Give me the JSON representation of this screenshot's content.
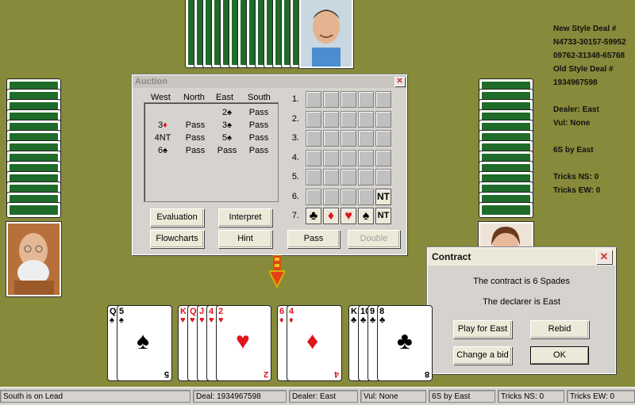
{
  "info": {
    "new_style_label": "New Style Deal #",
    "new_style_1": "N4733-30157-59952",
    "new_style_2": "09762-31348-65768",
    "old_style_label": "Old Style Deal #",
    "old_style_value": "1934967598",
    "dealer": "Dealer: East",
    "vul": "Vul: None",
    "contract": "6S by East",
    "tricks_ns": "Tricks NS: 0",
    "tricks_ew": "Tricks EW: 0"
  },
  "auction": {
    "title": "Auction",
    "headers": [
      "West",
      "North",
      "East",
      "South"
    ],
    "rows": [
      [
        "",
        "",
        "2♠",
        "Pass"
      ],
      [
        "3♦",
        "Pass",
        "3♠",
        "Pass"
      ],
      [
        "4NT",
        "Pass",
        "5♠",
        "Pass"
      ],
      [
        "6♠",
        "Pass",
        "Pass",
        "Pass"
      ]
    ],
    "levels": [
      "1.",
      "2.",
      "3.",
      "4.",
      "5.",
      "6.",
      "7."
    ],
    "level6_nt": "NT",
    "level7": [
      "♣",
      "♦",
      "♥",
      "♠",
      "NT"
    ],
    "buttons": {
      "evaluation": "Evaluation",
      "interpret": "Interpret",
      "flowcharts": "Flowcharts",
      "hint": "Hint",
      "pass": "Pass",
      "double": "Double"
    }
  },
  "contract_dialog": {
    "title": "Contract",
    "line1": "The contract is 6 Spades",
    "line2": "The declarer is East",
    "play_for_east": "Play for East",
    "rebid": "Rebid",
    "change_bid": "Change a bid",
    "ok": "OK"
  },
  "hand": {
    "spades": [
      "Q",
      "5"
    ],
    "hearts": [
      "K",
      "Q",
      "J",
      "4",
      "2"
    ],
    "diamonds": [
      "6",
      "4"
    ],
    "clubs": [
      "K",
      "10",
      "9",
      "8"
    ]
  },
  "status": {
    "lead": "South is on Lead",
    "deal": "Deal: 1934967598",
    "dealer": "Dealer: East",
    "vul": "Vul: None",
    "contract": "6S by East",
    "tricks_ns": "Tricks NS: 0",
    "tricks_ew": "Tricks EW: 0"
  },
  "colors": {
    "felt": "#868a3a",
    "card_back": "#1f6b2a",
    "red_suit": "#e0161b"
  }
}
